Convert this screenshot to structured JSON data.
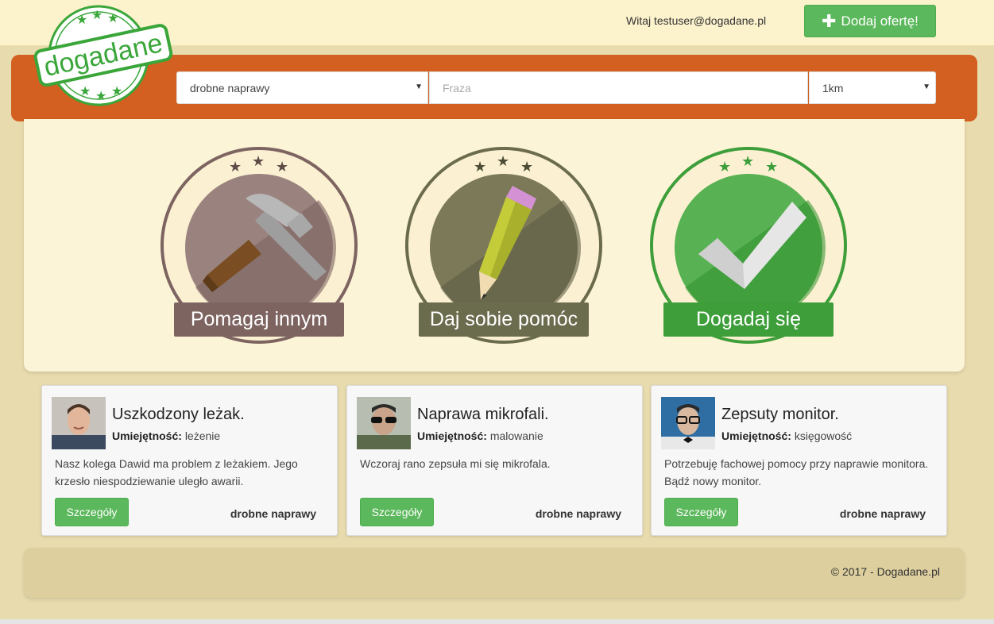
{
  "header": {
    "greeting": "Witaj testuser@dogadane.pl",
    "add_offer_label": "Dodaj ofertę!",
    "logo_text": "dogadane"
  },
  "search": {
    "category_selected": "drobne naprawy",
    "phrase_placeholder": "Fraza",
    "distance_selected": "1km"
  },
  "hero": {
    "badges": [
      {
        "label": "Pomagaj innym",
        "icon": "hammer-icon",
        "color": "#7d6461"
      },
      {
        "label": "Daj sobie pomóc",
        "icon": "pencil-icon",
        "color": "#6b6b4d"
      },
      {
        "label": "Dogadaj się",
        "icon": "checkmark-icon",
        "color": "#3d9e3a"
      }
    ]
  },
  "offers": [
    {
      "title": "Uszkodzony leżak.",
      "skill_label": "Umiejętność:",
      "skill": "leżenie",
      "description": "Nasz kolega Dawid ma problem z leżakiem. Jego krzesło niespodziewanie uległo awarii.",
      "details_label": "Szczegóły",
      "category": "drobne naprawy"
    },
    {
      "title": "Naprawa mikrofali.",
      "skill_label": "Umiejętność:",
      "skill": "malowanie",
      "description": "Wczoraj rano zepsuła mi się mikrofala.",
      "details_label": "Szczegóły",
      "category": "drobne naprawy"
    },
    {
      "title": "Zepsuty monitor.",
      "skill_label": "Umiejętność:",
      "skill": "księgowość",
      "description": "Potrzebuję fachowej pomocy przy naprawie monitora. Bądź nowy monitor.",
      "details_label": "Szczegóły",
      "category": "drobne naprawy"
    }
  ],
  "footer": {
    "copyright": "© 2017 - Dogadane.pl"
  }
}
